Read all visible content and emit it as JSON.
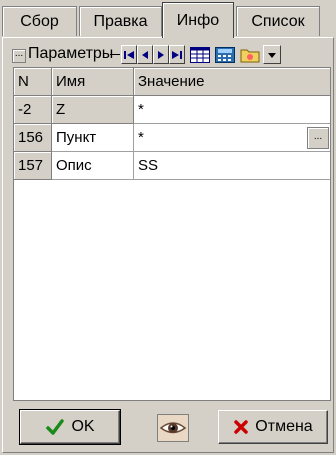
{
  "tabs": [
    {
      "label": "Сбор"
    },
    {
      "label": "Правка"
    },
    {
      "label": "Инфо"
    },
    {
      "label": "Список"
    }
  ],
  "toolbar": {
    "dots": "...",
    "params_label": "Параметры"
  },
  "grid": {
    "columns": [
      "N",
      "Имя",
      "Значение"
    ],
    "rows": [
      {
        "n": "-2",
        "name": "Z",
        "value": "*"
      },
      {
        "n": "156",
        "name": "Пункт",
        "value": "*"
      },
      {
        "n": "157",
        "name": "Опис",
        "value": "SS"
      }
    ],
    "ellipsis": "..."
  },
  "buttons": {
    "ok_label": "OK",
    "cancel_label": "Отмена"
  },
  "icons": {
    "ok": "check-icon",
    "cancel": "cross-icon",
    "eye": "eye-icon"
  },
  "colors": {
    "ok_check": "#1a8a1a",
    "cancel_cross": "#cc0000",
    "nav_arrows": "#000080",
    "face": "#d4d0c8"
  }
}
